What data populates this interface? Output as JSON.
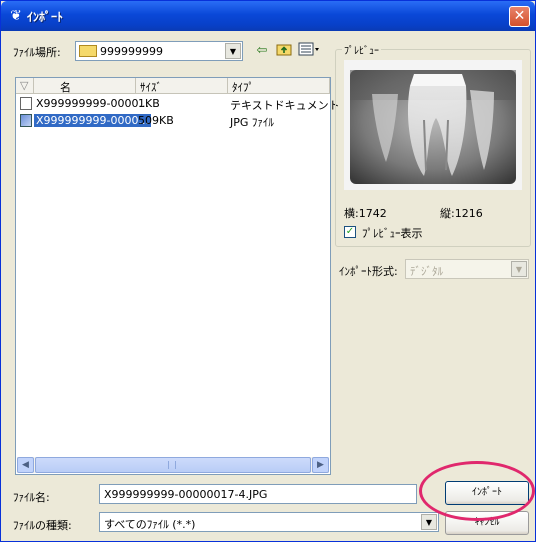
{
  "window": {
    "title": "ｲﾝﾎﾟｰﾄ",
    "title_icon": "app-icon",
    "close_label": "✕"
  },
  "location": {
    "label": "ﾌｧｲﾙ場所:",
    "value": "999999999",
    "folder_icon": "folder-icon"
  },
  "toolbar": {
    "back_icon": "back-arrow-icon",
    "up_icon": "folder-up-icon",
    "view_icon": "view-menu-icon"
  },
  "filelist": {
    "columns": [
      {
        "label": "名"
      },
      {
        "label": "ｻｲｽﾞ"
      },
      {
        "label": "ﾀｲﾌﾟ"
      }
    ],
    "rows": [
      {
        "name": "X999999999-0000...",
        "size": "1KB",
        "type": "テキストドキュメント",
        "icon": "text-file-icon",
        "selected": false
      },
      {
        "name": "X999999999-0000...",
        "size": "509KB",
        "type": "JPG ﾌｧｲﾙ",
        "icon": "image-file-icon",
        "selected": true
      }
    ]
  },
  "preview": {
    "caption": "ﾌﾟﾚﾋﾞｭｰ",
    "width_label": "横:1742",
    "height_label": "縦:1216",
    "show_preview_label": "ﾌﾟﾚﾋﾞｭｰ表示",
    "show_preview_checked": true
  },
  "import_format": {
    "label": "ｲﾝﾎﾟｰﾄ形式:",
    "value": "ﾃﾞｼﾞﾀﾙ"
  },
  "filename": {
    "label": "ﾌｧｲﾙ名:",
    "value": "X999999999-00000017-4.JPG"
  },
  "filetype": {
    "label": "ﾌｧｲﾙの種類:",
    "value": "すべてのﾌｧｲﾙ (*.*)"
  },
  "buttons": {
    "import_label": "ｲﾝﾎﾟｰﾄ",
    "cancel_label": "ｷｬﾝｾﾙ"
  },
  "colors": {
    "highlight_circle": "#e0286d",
    "selection": "#316ac5"
  }
}
